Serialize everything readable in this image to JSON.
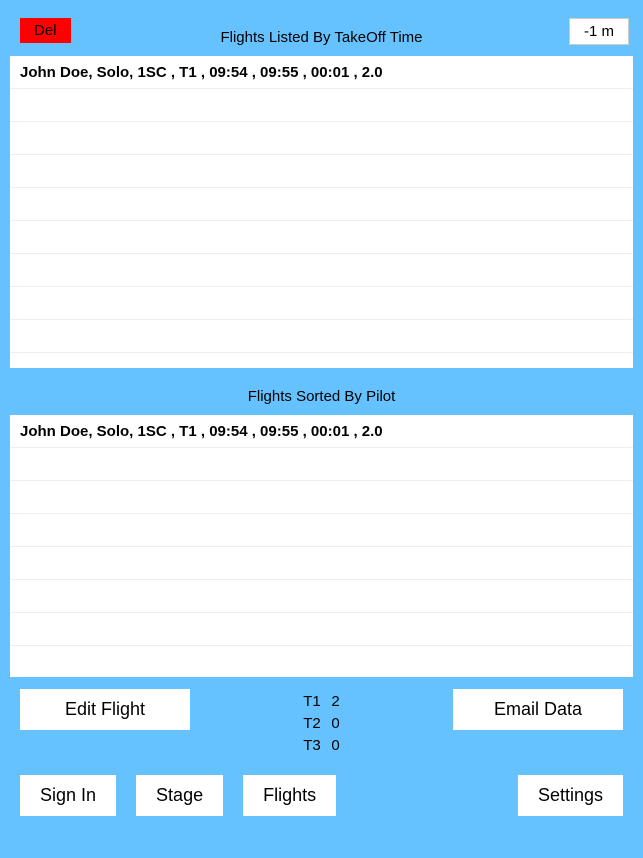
{
  "header": {
    "del_label": "Del",
    "title": "Flights Listed By TakeOff Time",
    "offset_label": "-1 m"
  },
  "list_by_takeoff": {
    "rows": [
      "John Doe,  Solo,  1SC , T1 , 09:54 , 09:55 , 00:01 , 2.0"
    ]
  },
  "section2_title": "Flights Sorted By Pilot",
  "list_by_pilot": {
    "rows": [
      "John Doe,  Solo,  1SC , T1 , 09:54 , 09:55 , 00:01 , 2.0"
    ]
  },
  "actions": {
    "edit_label": "Edit Flight",
    "email_label": "Email Data"
  },
  "tally": [
    {
      "label": "T1",
      "value": "2"
    },
    {
      "label": "T2",
      "value": "0"
    },
    {
      "label": "T3",
      "value": "0"
    }
  ],
  "nav": {
    "signin": "Sign In",
    "stage": "Stage",
    "flights": "Flights",
    "settings": "Settings"
  }
}
